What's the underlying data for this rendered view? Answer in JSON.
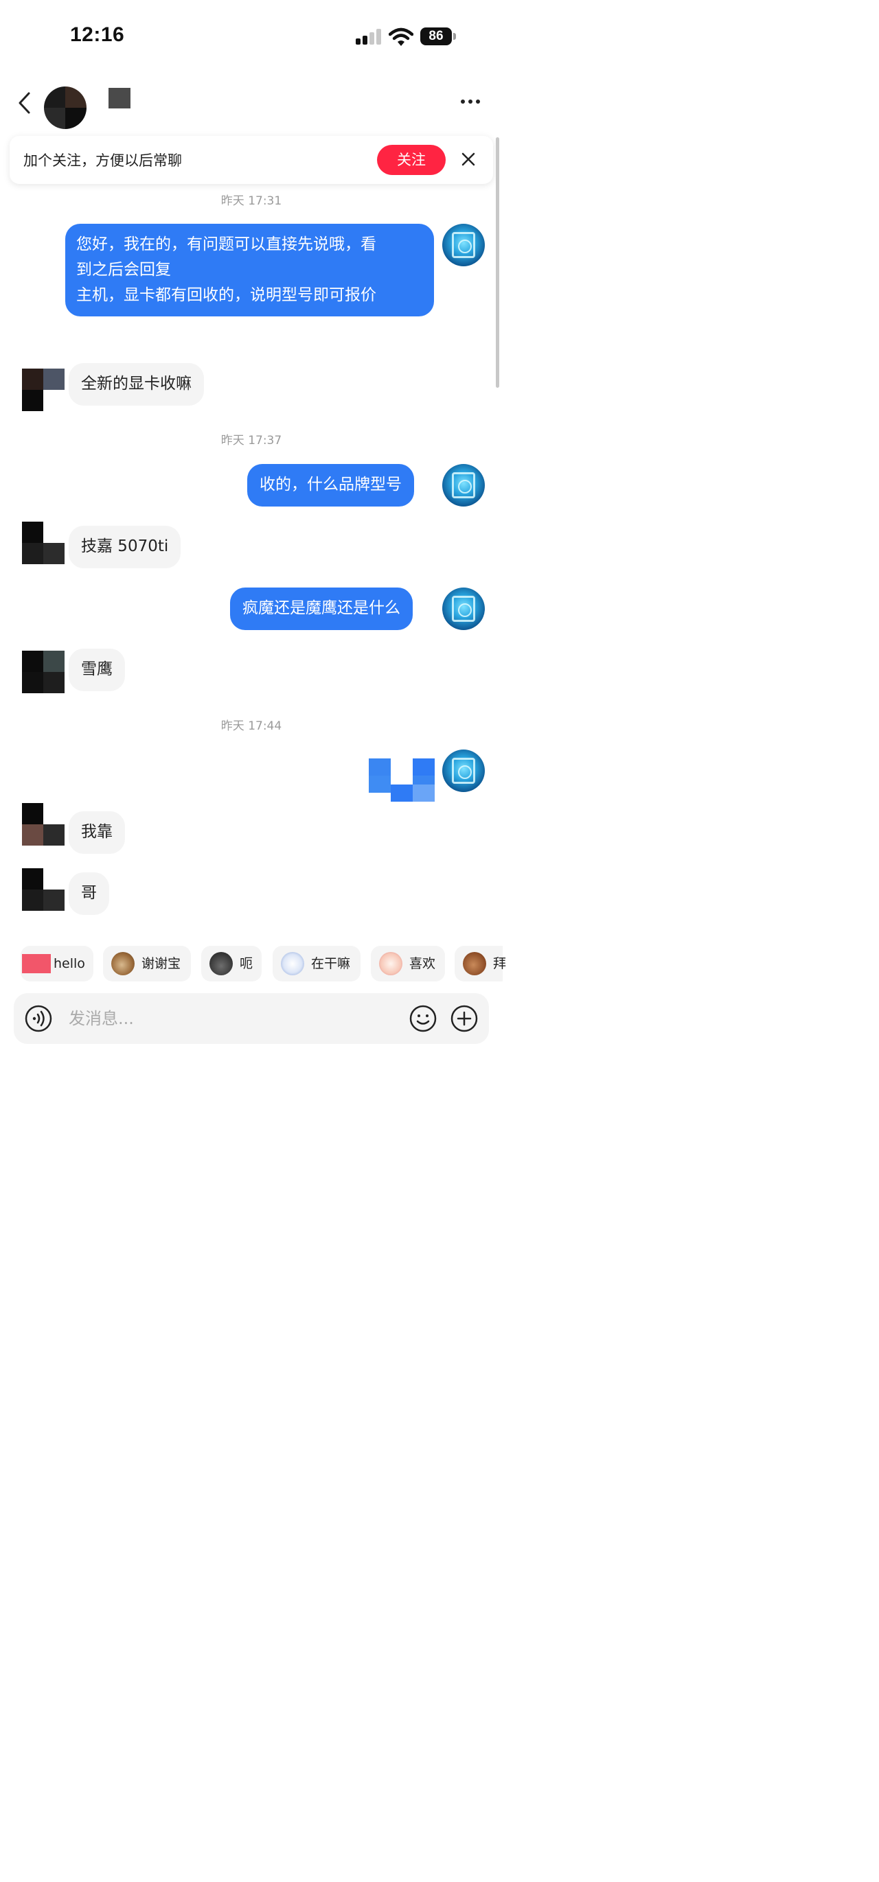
{
  "status_bar": {
    "time": "12:16",
    "battery": "86"
  },
  "header": {
    "back_icon": "chevron-left-icon",
    "more_icon": "more-icon"
  },
  "follow_banner": {
    "text": "加个关注，方便以后常聊",
    "button": "关注",
    "close_icon": "close-icon"
  },
  "colors": {
    "accent_red": "#ff2442",
    "outgoing_bubble": "#2f7bf5",
    "incoming_bubble": "#f4f4f4"
  },
  "chat": {
    "timestamps": [
      "昨天 17:31",
      "昨天 17:37",
      "昨天 17:44"
    ],
    "messages": [
      {
        "from": "self",
        "lines": [
          "您好，我在的，有问题可以直接先说哦，看",
          "到之后会回复",
          "主机，显卡都有回收的，说明型号即可报价"
        ]
      },
      {
        "from": "other",
        "text": "全新的显卡收嘛"
      },
      {
        "from": "self",
        "text": "收的，什么品牌型号"
      },
      {
        "from": "other",
        "text": "技嘉 5070ti"
      },
      {
        "from": "self",
        "text": "疯魔还是魔鹰还是什么"
      },
      {
        "from": "other",
        "text": "雪鹰"
      },
      {
        "from": "self",
        "type": "image"
      },
      {
        "from": "other",
        "text": "我靠"
      },
      {
        "from": "other",
        "text": "哥"
      }
    ]
  },
  "quick_replies": [
    {
      "label": "hello",
      "icon": "wave-sticker-icon"
    },
    {
      "label": "谢谢宝",
      "icon": "monkey-sticker-icon"
    },
    {
      "label": "呃",
      "icon": "cat-sticker-icon"
    },
    {
      "label": "在干嘛",
      "icon": "face-sticker-icon"
    },
    {
      "label": "喜欢",
      "icon": "blush-sticker-icon"
    },
    {
      "label": "拜",
      "icon": "bow-sticker-icon"
    }
  ],
  "input_bar": {
    "placeholder": "发消息...",
    "voice_icon": "voice-icon",
    "emoji_icon": "emoji-icon",
    "plus_icon": "plus-icon"
  }
}
